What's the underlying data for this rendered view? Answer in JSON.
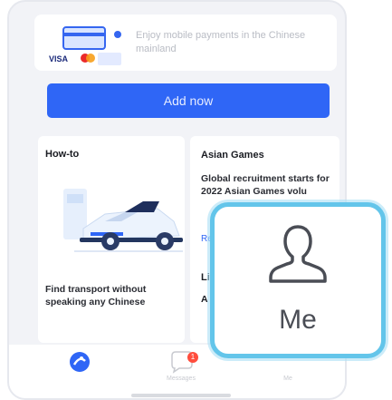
{
  "promo": {
    "text": "Enjoy mobile payments in the Chinese mainland",
    "visa_label": "VISA"
  },
  "add_button": {
    "label": "Add now"
  },
  "howto": {
    "title": "How-to",
    "body": "Find transport without speaking any Chinese"
  },
  "asian_games": {
    "title": "Asian Games",
    "body": "Global recruitment starts for 2022 Asian Games volu",
    "link": "Rea"
  },
  "life": {
    "title": "Lif",
    "body": "A d"
  },
  "tabbar": {
    "messages_label": "Messages",
    "messages_badge": "1",
    "me_small_label": "Me"
  },
  "me_overlay": {
    "label": "Me"
  },
  "colors": {
    "accent": "#2f66f6",
    "highlight_border": "#63c5ea",
    "badge": "#ff4d3d"
  }
}
